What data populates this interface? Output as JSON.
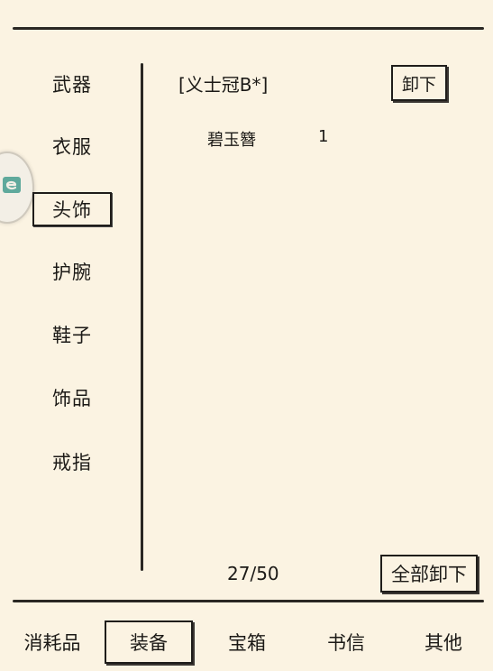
{
  "sidebar": {
    "items": [
      {
        "label": "武器"
      },
      {
        "label": "衣服"
      },
      {
        "label": "头饰",
        "active": true
      },
      {
        "label": "护腕"
      },
      {
        "label": "鞋子"
      },
      {
        "label": "饰品"
      },
      {
        "label": "戒指"
      }
    ]
  },
  "equipped": {
    "title": "[义士冠B*]",
    "unequip_label": "卸下",
    "rows": [
      {
        "name": "碧玉簪",
        "count": "1"
      }
    ]
  },
  "footer": {
    "capacity": "27/50",
    "unequip_all_label": "全部卸下"
  },
  "tabs": [
    {
      "label": "消耗品"
    },
    {
      "label": "装备",
      "active": true
    },
    {
      "label": "宝箱"
    },
    {
      "label": "书信"
    },
    {
      "label": "其他"
    }
  ],
  "colors": {
    "background": "#fbf3e2",
    "ink": "#1c1a17",
    "float_icon": "#5fa99c"
  },
  "icons": {
    "float_button": "e-logo-icon"
  }
}
